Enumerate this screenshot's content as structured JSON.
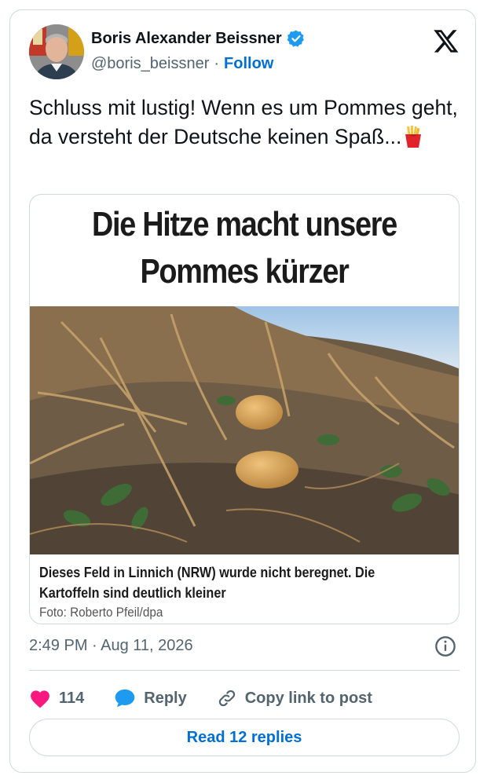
{
  "author": {
    "name": "Boris Alexander Beissner",
    "handle": "@boris_beissner",
    "separator": "·",
    "follow_label": "Follow"
  },
  "tweet": {
    "text": "Schluss mit lustig! Wenn es um Pommes geht, da versteht der Deutsche keinen Spaß...",
    "emoji": "french-fries-emoji"
  },
  "media": {
    "headline_line1": "Die Hitze macht unsere",
    "headline_line2": "Pommes kürzer",
    "caption": "Dieses Feld in Linnich (NRW) wurde nicht beregnet. Die Kartoffeln sind deutlich kleiner",
    "credit": "Foto: Roberto Pfeil/dpa"
  },
  "meta": {
    "timestamp": "2:49 PM · Aug 11, 2026"
  },
  "actions": {
    "like_count": "114",
    "reply_label": "Reply",
    "copy_label": "Copy link to post"
  },
  "read_replies_label": "Read 12 replies",
  "colors": {
    "accent": "#1d9bf0",
    "link": "#006fd6",
    "like": "#f91880",
    "text": "#0f1419",
    "muted": "#536471",
    "border": "#cfd9de"
  }
}
